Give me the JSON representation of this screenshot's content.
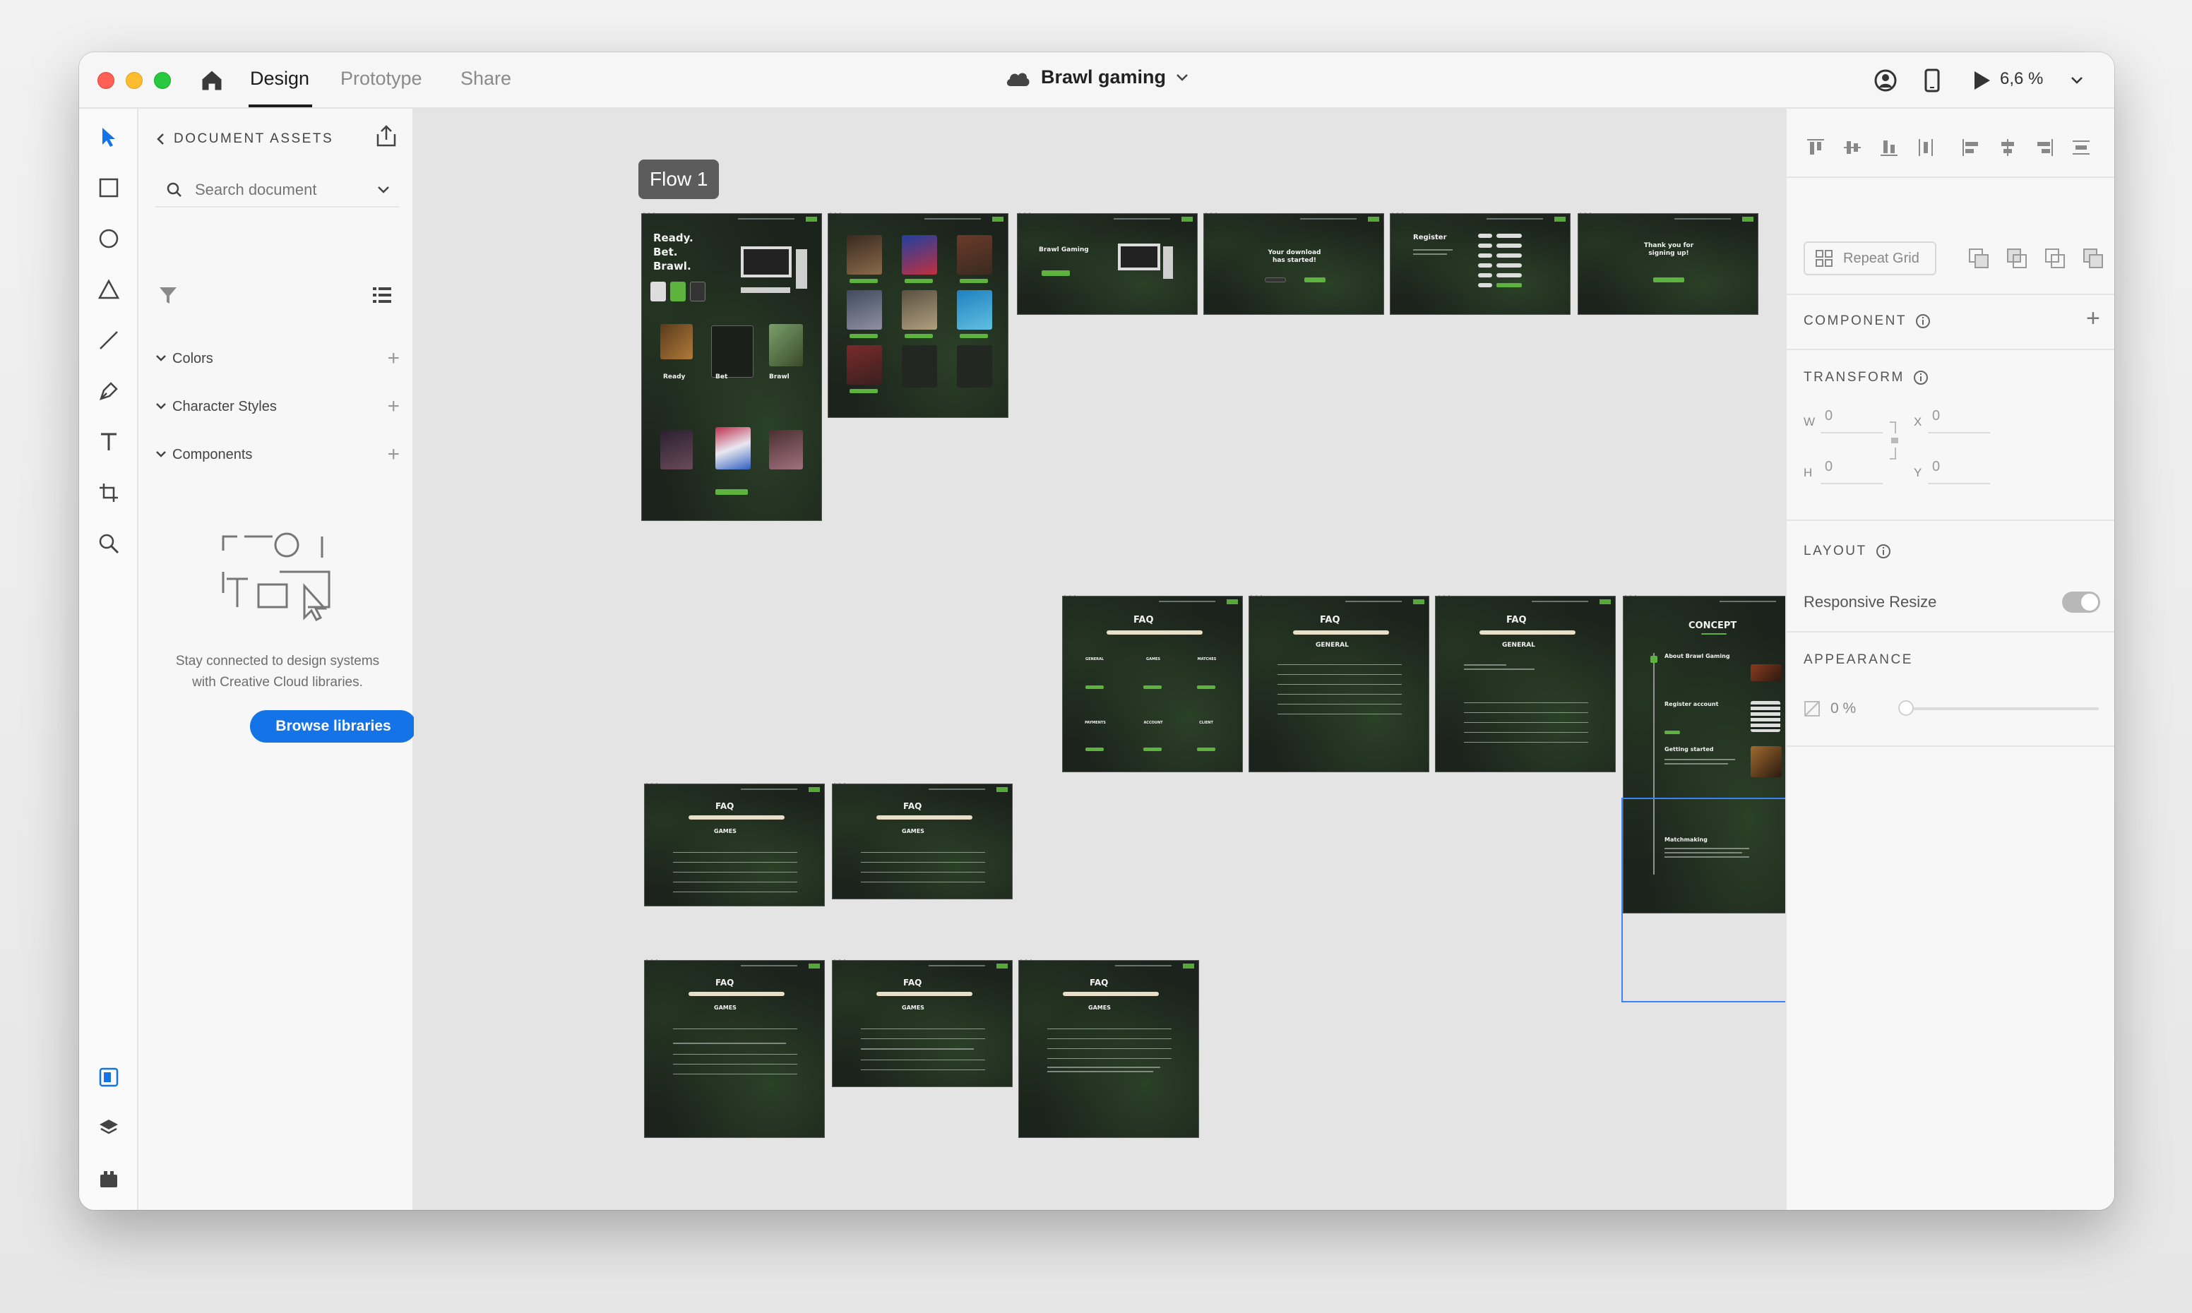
{
  "window": {
    "nav_tabs": [
      "Design",
      "Prototype",
      "Share"
    ],
    "active_tab": "Design",
    "document_title": "Brawl gaming",
    "zoom": "6,6 %"
  },
  "assets": {
    "header": "DOCUMENT ASSETS",
    "search_placeholder": "Search document",
    "sections": [
      "Colors",
      "Character Styles",
      "Components"
    ],
    "empty_message_line1": "Stay connected to design systems",
    "empty_message_line2": "with Creative Cloud libraries.",
    "browse_button": "Browse libraries"
  },
  "canvas": {
    "flow_label": "Flow 1",
    "boards": {
      "hero": [
        "Ready.",
        "Bet.",
        "Brawl."
      ],
      "hero_cols": [
        "Ready",
        "Bet",
        "Brawl"
      ],
      "download_brand": "Brawl Gaming",
      "download_started": [
        "Your download",
        "has started!"
      ],
      "register": "Register",
      "thanks": [
        "Thank you for",
        "signing up!"
      ],
      "faq": "FAQ",
      "general": "GENERAL",
      "games": "GAMES",
      "concept": "CONCEPT",
      "faq_categories": [
        "GENERAL",
        "GAMES",
        "MATCHES",
        "PAYMENTS",
        "ACCOUNT",
        "CLIENT"
      ],
      "concept_sections": [
        "About Brawl Gaming",
        "Register account",
        "Getting started",
        "Matchmaking"
      ]
    }
  },
  "props": {
    "repeat_grid": "Repeat Grid",
    "component_header": "COMPONENT",
    "transform_header": "TRANSFORM",
    "w_label": "W",
    "h_label": "H",
    "x_label": "X",
    "y_label": "Y",
    "w": "0",
    "h": "0",
    "x": "0",
    "y": "0",
    "layout_header": "LAYOUT",
    "responsive_resize": "Responsive Resize",
    "appearance_header": "APPEARANCE",
    "opacity": "0 %"
  }
}
